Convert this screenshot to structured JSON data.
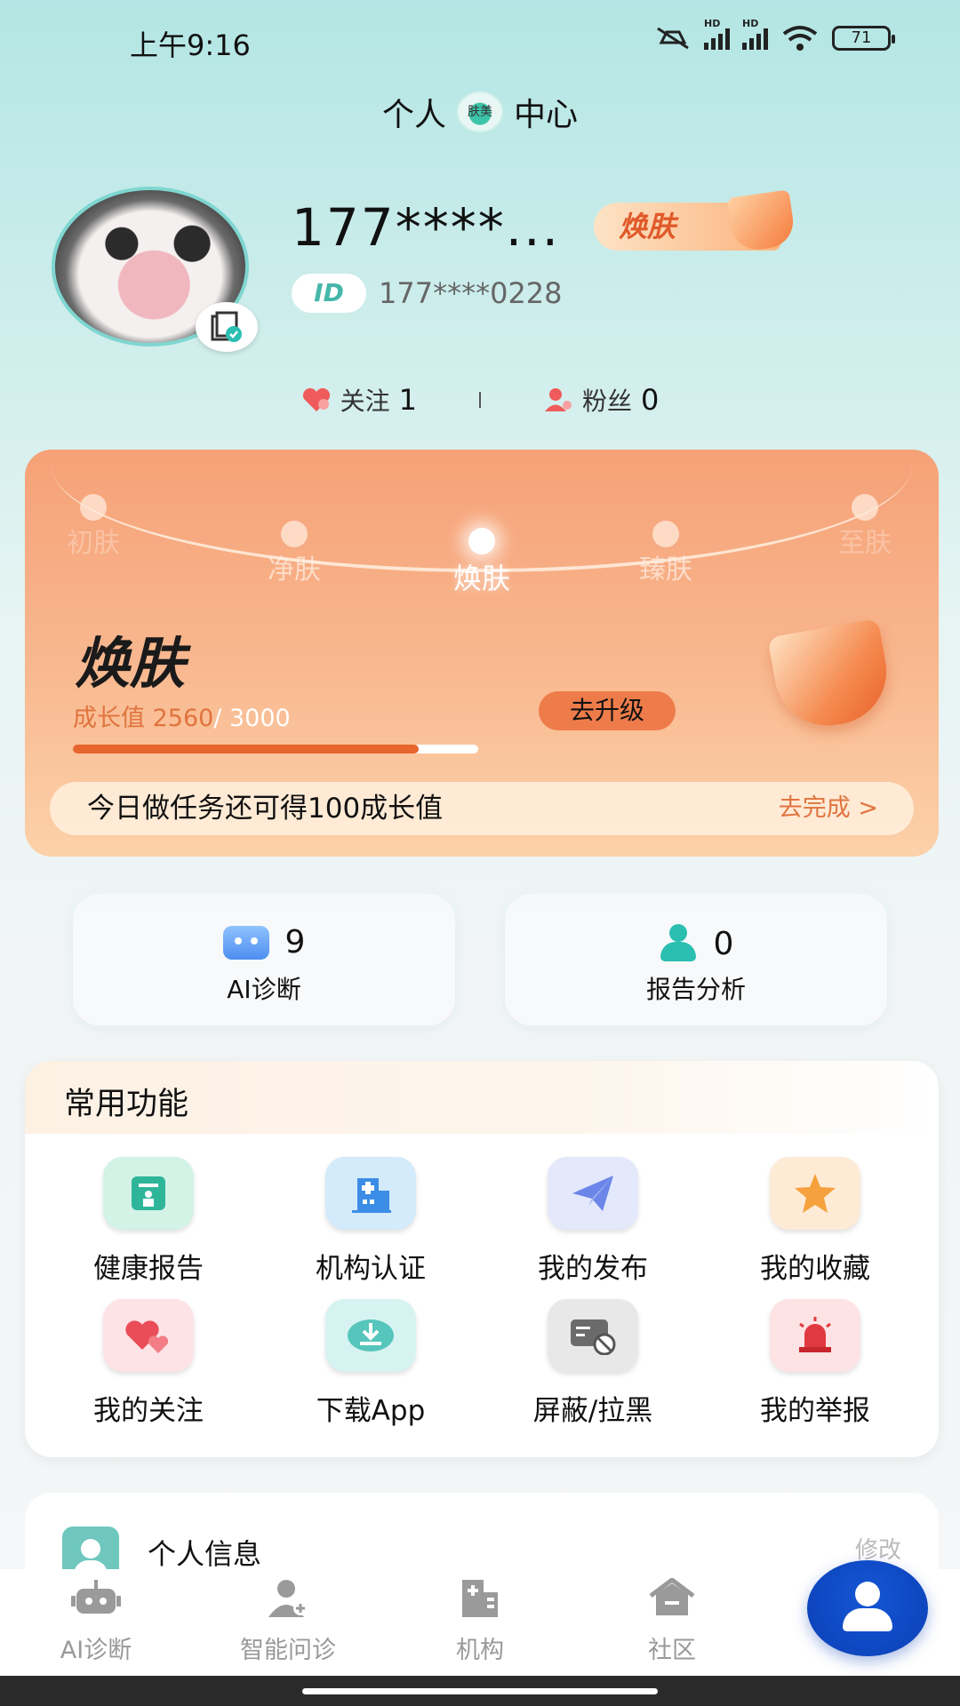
{
  "status_bar": {
    "time": "上午9:16",
    "battery": "71",
    "hd1": "HD",
    "hd2": "HD"
  },
  "header": {
    "title_left": "个人",
    "title_right": "中心",
    "logo_text": "肤美"
  },
  "profile": {
    "username": "177****...",
    "level_tag": "焕肤",
    "id_label": "ID",
    "id_value": "177****0228",
    "follow_label": "关注",
    "follow_count": "1",
    "fans_label": "粉丝",
    "fans_count": "0"
  },
  "level_card": {
    "stages": [
      "初肤",
      "净肤",
      "焕肤",
      "臻肤",
      "至肤"
    ],
    "current_level": "焕肤",
    "growth_label": "成长值 2560",
    "growth_max": "/ 3000",
    "progress": 0.853,
    "upgrade_button": "去升级",
    "task_text": "今日做任务还可得100成长值",
    "task_link": "去完成 >"
  },
  "stats": [
    {
      "value": "9",
      "label": "AI诊断",
      "icon": "robot-icon"
    },
    {
      "value": "0",
      "label": "报告分析",
      "icon": "doctor-icon"
    }
  ],
  "functions": {
    "title": "常用功能",
    "items": [
      {
        "label": "健康报告",
        "icon": "report-icon",
        "color": "#d3f3e6"
      },
      {
        "label": "机构认证",
        "icon": "hospital-icon",
        "color": "#d3ebfb"
      },
      {
        "label": "我的发布",
        "icon": "paper-plane-icon",
        "color": "#e3e8fb"
      },
      {
        "label": "我的收藏",
        "icon": "star-icon",
        "color": "#fdebd6"
      },
      {
        "label": "我的关注",
        "icon": "hearts-icon",
        "color": "#fde3e5"
      },
      {
        "label": "下载App",
        "icon": "download-icon",
        "color": "#d6f3f1"
      },
      {
        "label": "屏蔽/拉黑",
        "icon": "block-icon",
        "color": "#e8e8e8"
      },
      {
        "label": "我的举报",
        "icon": "alarm-icon",
        "color": "#fde3e3"
      }
    ]
  },
  "info": {
    "label": "个人信息",
    "right": "修改"
  },
  "bottom_nav": [
    {
      "label": "AI诊断",
      "icon": "robot-icon"
    },
    {
      "label": "智能问诊",
      "icon": "doctor-icon"
    },
    {
      "label": "机构",
      "icon": "building-icon"
    },
    {
      "label": "社区",
      "icon": "home-icon"
    }
  ],
  "colors": {
    "accent": "#ee7c4a",
    "brand_blue": "#1556d6",
    "teal": "#2bbfb1"
  }
}
